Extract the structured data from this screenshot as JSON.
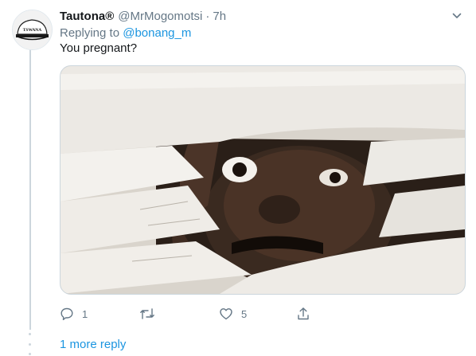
{
  "tweet": {
    "display_name": "Tautona®",
    "handle": "@MrMogomotsi",
    "separator": "·",
    "time": "7h",
    "replying_prefix": "Replying to",
    "replying_handle": "@bonang_m",
    "text": "You pregnant?",
    "avatar_text": "TSWANA",
    "icons": {
      "caret": "chevron-down-icon",
      "reply": "reply-icon",
      "retweet": "retweet-icon",
      "like": "heart-icon",
      "share": "share-icon"
    },
    "actions": {
      "reply_count": "1",
      "retweet_count": "",
      "like_count": "5"
    }
  },
  "more_replies": "1 more reply",
  "colors": {
    "link": "#1b95e0",
    "muted": "#657786",
    "border": "#ccd6dd",
    "text": "#14171a"
  }
}
